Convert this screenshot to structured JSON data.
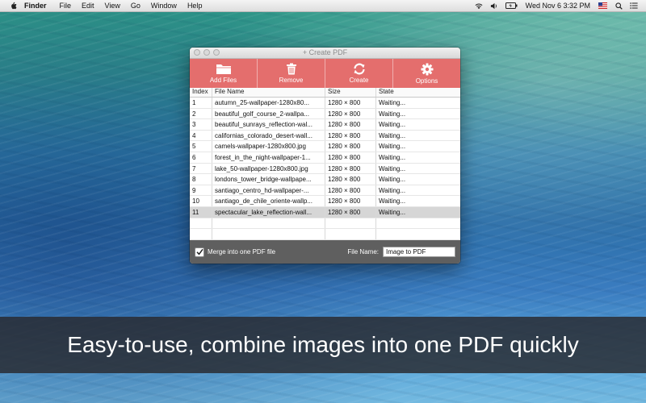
{
  "menubar": {
    "app": "Finder",
    "items": [
      "File",
      "Edit",
      "View",
      "Go",
      "Window",
      "Help"
    ],
    "clock": "Wed Nov 6  3:32 PM"
  },
  "window": {
    "title": "+ Create PDF",
    "toolbar": {
      "add_files": "Add Files",
      "remove": "Remove",
      "create": "Create",
      "options": "Options"
    },
    "columns": {
      "index": "Index",
      "file_name": "File Name",
      "size": "Size",
      "state": "State"
    },
    "rows": [
      {
        "index": "1",
        "name": "autumn_25-wallpaper-1280x80...",
        "size": "1280 × 800",
        "state": "Waiting..."
      },
      {
        "index": "2",
        "name": "beautiful_golf_course_2-wallpa...",
        "size": "1280 × 800",
        "state": "Waiting..."
      },
      {
        "index": "3",
        "name": "beautiful_sunrays_reflection-wal...",
        "size": "1280 × 800",
        "state": "Waiting..."
      },
      {
        "index": "4",
        "name": "californias_colorado_desert-wall...",
        "size": "1280 × 800",
        "state": "Waiting..."
      },
      {
        "index": "5",
        "name": "camels-wallpaper-1280x800.jpg",
        "size": "1280 × 800",
        "state": "Waiting..."
      },
      {
        "index": "6",
        "name": "forest_in_the_night-wallpaper-1...",
        "size": "1280 × 800",
        "state": "Waiting..."
      },
      {
        "index": "7",
        "name": "lake_50-wallpaper-1280x800.jpg",
        "size": "1280 × 800",
        "state": "Waiting..."
      },
      {
        "index": "8",
        "name": "londons_tower_bridge-wallpape...",
        "size": "1280 × 800",
        "state": "Waiting..."
      },
      {
        "index": "9",
        "name": "santiago_centro_hd-wallpaper-...",
        "size": "1280 × 800",
        "state": "Waiting..."
      },
      {
        "index": "10",
        "name": "santiago_de_chile_oriente-wallp...",
        "size": "1280 × 800",
        "state": "Waiting..."
      },
      {
        "index": "11",
        "name": "spectacular_lake_reflection-wall...",
        "size": "1280 × 800",
        "state": "Waiting..."
      }
    ],
    "merge_label": "Merge into one PDF file",
    "merge_checked": true,
    "file_name_label": "File Name:",
    "file_name_value": "Image to PDF"
  },
  "banner": {
    "text": "Easy-to-use, combine images into one PDF quickly"
  },
  "colors": {
    "toolbar": "#e46e6d",
    "bottom_bar": "#5f5f5f"
  }
}
